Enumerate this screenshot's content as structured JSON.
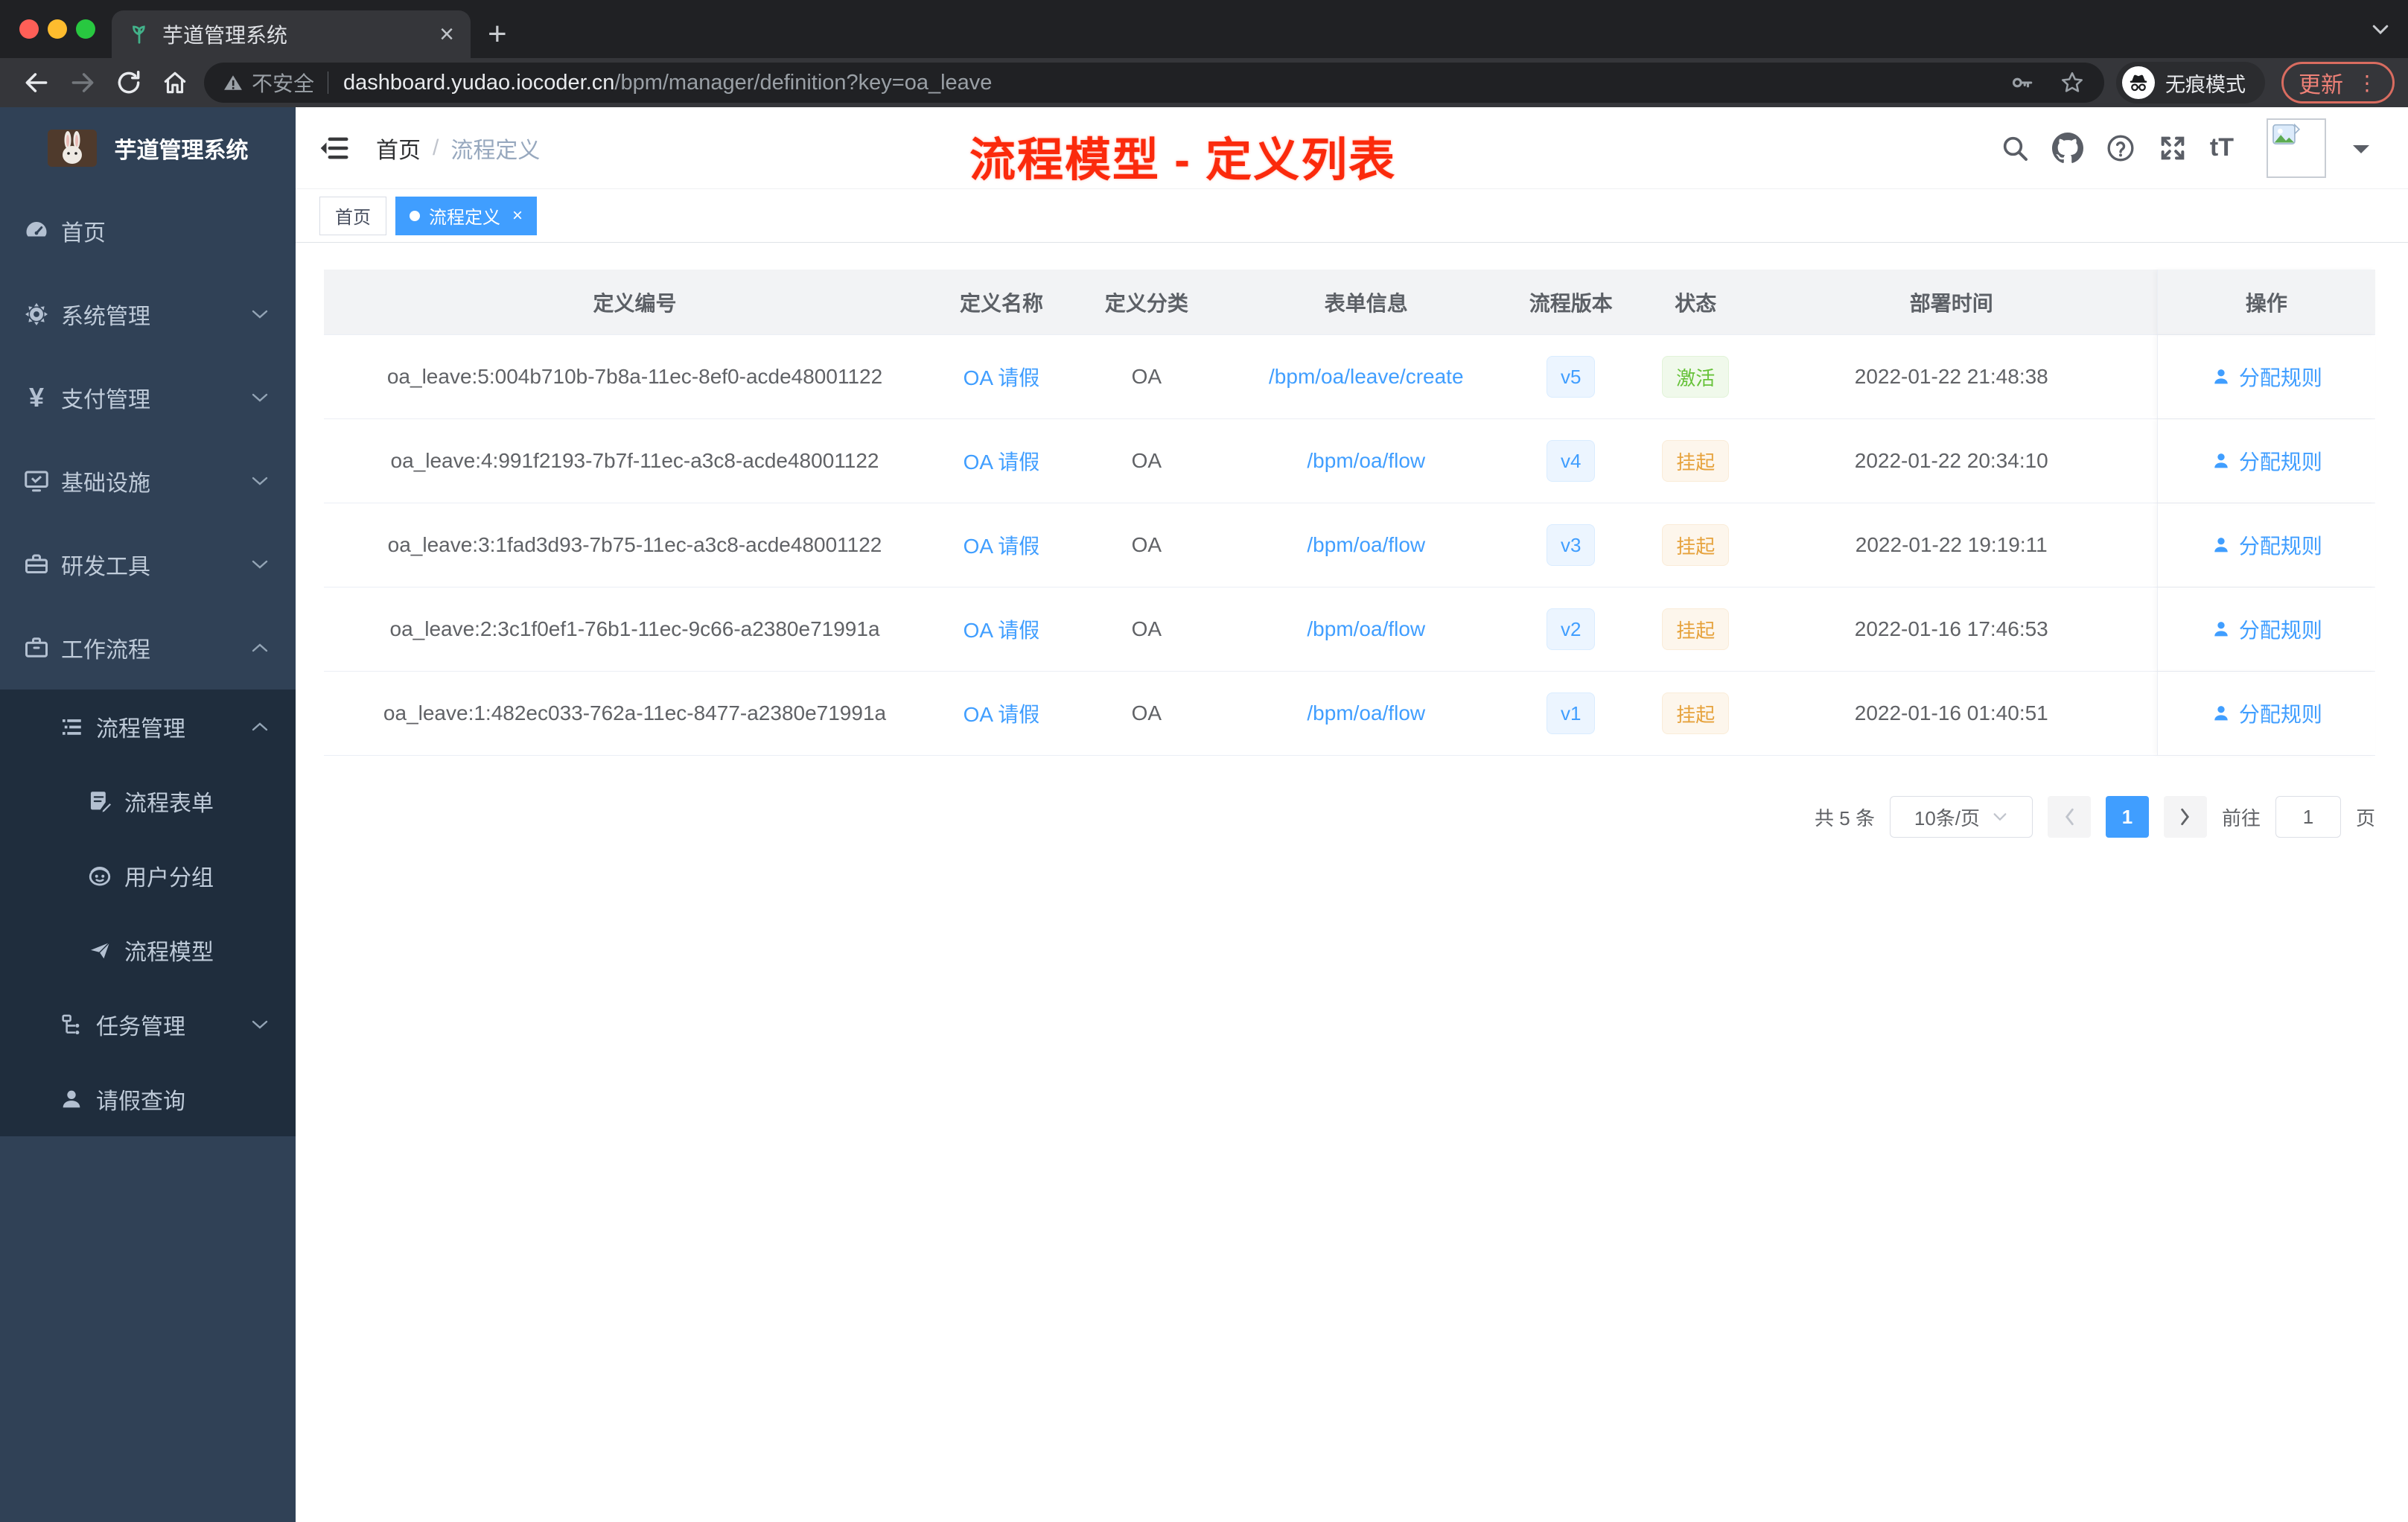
{
  "browser": {
    "tab_title": "芋道管理系统",
    "security_label": "不安全",
    "url_domain": "dashboard.yudao.iocoder.cn",
    "url_path": "/bpm/manager/definition?key=oa_leave",
    "incognito_label": "无痕模式",
    "update_label": "更新"
  },
  "sidebar": {
    "app_title": "芋道管理系统",
    "items": [
      {
        "label": "首页"
      },
      {
        "label": "系统管理"
      },
      {
        "label": "支付管理"
      },
      {
        "label": "基础设施"
      },
      {
        "label": "研发工具"
      },
      {
        "label": "工作流程"
      },
      {
        "label": "流程管理"
      },
      {
        "label": "流程表单"
      },
      {
        "label": "用户分组"
      },
      {
        "label": "流程模型"
      },
      {
        "label": "任务管理"
      },
      {
        "label": "请假查询"
      }
    ]
  },
  "header": {
    "breadcrumb_home": "首页",
    "breadcrumb_current": "流程定义",
    "annotation": "流程模型 - 定义列表"
  },
  "tags": {
    "items": [
      {
        "label": "首页",
        "active": false
      },
      {
        "label": "流程定义",
        "active": true
      }
    ]
  },
  "table": {
    "columns": [
      "定义编号",
      "定义名称",
      "定义分类",
      "表单信息",
      "流程版本",
      "状态",
      "部署时间",
      "操作"
    ],
    "rows": [
      {
        "id": "oa_leave:5:004b710b-7b8a-11ec-8ef0-acde48001122",
        "name": "OA 请假",
        "category": "OA",
        "form": "/bpm/oa/leave/create",
        "version": "v5",
        "status": "激活",
        "status_type": "success",
        "deployed": "2022-01-22 21:48:38",
        "action": "分配规则"
      },
      {
        "id": "oa_leave:4:991f2193-7b7f-11ec-a3c8-acde48001122",
        "name": "OA 请假",
        "category": "OA",
        "form": "/bpm/oa/flow",
        "version": "v4",
        "status": "挂起",
        "status_type": "warning",
        "deployed": "2022-01-22 20:34:10",
        "action": "分配规则"
      },
      {
        "id": "oa_leave:3:1fad3d93-7b75-11ec-a3c8-acde48001122",
        "name": "OA 请假",
        "category": "OA",
        "form": "/bpm/oa/flow",
        "version": "v3",
        "status": "挂起",
        "status_type": "warning",
        "deployed": "2022-01-22 19:19:11",
        "action": "分配规则"
      },
      {
        "id": "oa_leave:2:3c1f0ef1-76b1-11ec-9c66-a2380e71991a",
        "name": "OA 请假",
        "category": "OA",
        "form": "/bpm/oa/flow",
        "version": "v2",
        "status": "挂起",
        "status_type": "warning",
        "deployed": "2022-01-16 17:46:53",
        "action": "分配规则"
      },
      {
        "id": "oa_leave:1:482ec033-762a-11ec-8477-a2380e71991a",
        "name": "OA 请假",
        "category": "OA",
        "form": "/bpm/oa/flow",
        "version": "v1",
        "status": "挂起",
        "status_type": "warning",
        "deployed": "2022-01-16 01:40:51",
        "action": "分配规则"
      }
    ]
  },
  "pagination": {
    "total": "共 5 条",
    "page_size": "10条/页",
    "current_page": "1",
    "goto_label": "前往",
    "goto_value": "1",
    "page_unit": "页"
  }
}
